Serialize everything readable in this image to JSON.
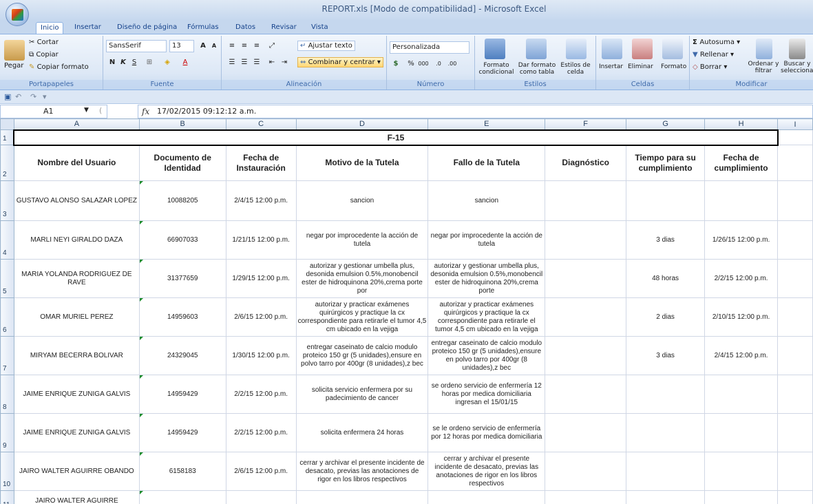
{
  "window": {
    "title": "REPORT.xls  [Modo de compatibilidad] - Microsoft Excel"
  },
  "tabs": [
    "Inicio",
    "Insertar",
    "Diseño de página",
    "Fórmulas",
    "Datos",
    "Revisar",
    "Vista"
  ],
  "ribbon": {
    "clipboard": {
      "paste": "Pegar",
      "cut": "Cortar",
      "copy": "Copiar",
      "format_painter": "Copiar formato",
      "label": "Portapapeles"
    },
    "font": {
      "name": "SansSerif",
      "size": "13",
      "label": "Fuente"
    },
    "alignment": {
      "wrap": "Ajustar texto",
      "merge": "Combinar y centrar",
      "label": "Alineación"
    },
    "number": {
      "format": "Personalizada",
      "label": "Número"
    },
    "styles": {
      "cond": "Formato condicional",
      "table": "Dar formato como tabla",
      "cell": "Estilos de celda",
      "label": "Estilos"
    },
    "cells": {
      "insert": "Insertar",
      "delete": "Eliminar",
      "format": "Formato",
      "label": "Celdas"
    },
    "editing": {
      "autosum": "Autosuma",
      "fill": "Rellenar",
      "clear": "Borrar",
      "sort": "Ordenar y filtrar",
      "find": "Buscar y seleccionar",
      "label": "Modificar"
    }
  },
  "formula_bar": {
    "cell_ref": "A1",
    "fx": "fx",
    "value": "17/02/2015 09:12:12 a.m."
  },
  "sheet": {
    "columns": [
      "A",
      "B",
      "C",
      "D",
      "E",
      "F",
      "G",
      "H",
      "I"
    ],
    "title": "F-15",
    "headers": [
      "Nombre del Usuario",
      "Documento de Identidad",
      "Fecha de Instauración",
      "Motivo de la Tutela",
      "Fallo de la Tutela",
      "Diagnóstico",
      "Tiempo para su cumplimiento",
      "Fecha de cumplimiento"
    ],
    "rows": [
      {
        "n": "3",
        "cells": [
          "GUSTAVO ALONSO SALAZAR LOPEZ",
          "10088205",
          "2/4/15 12:00 p.m.",
          "sancion",
          "sancion",
          "",
          "",
          ""
        ]
      },
      {
        "n": "4",
        "cells": [
          "MARLI NEYI GIRALDO DAZA",
          "66907033",
          "1/21/15 12:00 p.m.",
          "negar por improcedente la acción de tutela",
          "negar por improcedente la acción de tutela",
          "",
          "3 dias",
          "1/26/15 12:00 p.m."
        ]
      },
      {
        "n": "5",
        "cells": [
          "MARIA YOLANDA RODRIGUEZ DE RAVE",
          "31377659",
          "1/29/15 12:00 p.m.",
          "autorizar y gestionar umbella plus, desonida emulsion 0.5%,monobencil ester de hidroquinona 20%,crema porte por",
          "autorizar y gestionar umbella plus, desonida emulsion 0.5%,monobencil ester de hidroquinona 20%,crema porte",
          "",
          "48 horas",
          "2/2/15 12:00 p.m."
        ]
      },
      {
        "n": "6",
        "cells": [
          "OMAR  MURIEL PEREZ",
          "14959603",
          "2/6/15 12:00 p.m.",
          "autorizar y practicar exámenes quirúrgicos y practique la cx correspondiente para retirarle el tumor 4,5 cm ubicado en la vejiga",
          "autorizar y practicar exámenes quirúrgicos y practique la cx correspondiente para retirarle el tumor 4,5 cm ubicado en la vejiga",
          "",
          "2 dias",
          "2/10/15 12:00 p.m."
        ]
      },
      {
        "n": "7",
        "cells": [
          "MIRYAM  BECERRA BOLIVAR",
          "24329045",
          "1/30/15 12:00 p.m.",
          "entregar caseinato de calcio modulo proteico 150 gr (5 unidades),ensure en polvo tarro por 400gr (8 unidades),z bec",
          "entregar caseinato de calcio modulo proteico 150 gr (5 unidades),ensure en polvo tarro por 400gr (8 unidades),z bec",
          "",
          "3 dias",
          "2/4/15 12:00 p.m."
        ]
      },
      {
        "n": "8",
        "cells": [
          "JAIME ENRIQUE ZUÑIGA GALVIS",
          "14959429",
          "2/2/15 12:00 p.m.",
          "solicita servicio enfermera por su padecimiento de cancer",
          "se ordeno servicio de enfermería 12 horas por medica domiciliaria ingresan el 15/01/15",
          "",
          "",
          ""
        ]
      },
      {
        "n": "9",
        "cells": [
          "JAIME ENRIQUE ZUÑIGA GALVIS",
          "14959429",
          "2/2/15 12:00 p.m.",
          "solicita enfermera 24 horas",
          "se le ordeno servicio de enfermería por 12 horas por medica domiciliaria",
          "",
          "",
          ""
        ]
      },
      {
        "n": "10",
        "cells": [
          "JAIRO WALTER AGUIRRE OBANDO",
          "6158183",
          "2/6/15 12:00 p.m.",
          "cerrar y archivar el presente incidente de desacato, previas las anotaciones de rigor en los libros respectivos",
          "cerrar y archivar el presente incidente de desacato, previas las anotaciones de rigor en los libros respectivos",
          "",
          "",
          ""
        ]
      },
      {
        "n": "11",
        "cells": [
          "JAIRO WALTER AGUIRRE",
          "",
          "",
          "",
          "",
          "",
          "",
          ""
        ]
      }
    ]
  },
  "colors": {
    "ribbon": "#dde8f6",
    "header": "#dbe5f3",
    "accent": "#15428b"
  }
}
